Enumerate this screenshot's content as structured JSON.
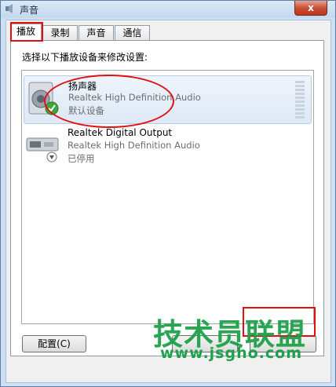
{
  "window": {
    "title": "声音",
    "close_glyph": "x"
  },
  "tabs": [
    {
      "label": "播放",
      "active": true
    },
    {
      "label": "录制",
      "active": false
    },
    {
      "label": "声音",
      "active": false
    },
    {
      "label": "通信",
      "active": false
    }
  ],
  "instruction": "选择以下播放设备来修改设置:",
  "devices": [
    {
      "name": "扬声器",
      "description": "Realtek High Definition Audio",
      "status": "默认设备",
      "icon": "speaker-icon",
      "selected": true
    },
    {
      "name": "Realtek Digital Output",
      "description": "Realtek High Definition Audio",
      "status": "已停用",
      "icon": "digital-output-icon",
      "selected": false
    }
  ],
  "buttons": {
    "configure": "配置(C)"
  },
  "watermark": {
    "line1": "技术员联盟",
    "line2": "www.jsgho.com"
  },
  "colors": {
    "annotation": "#e01010",
    "watermark": "#1ea14a",
    "selection": "#dde9f6"
  }
}
